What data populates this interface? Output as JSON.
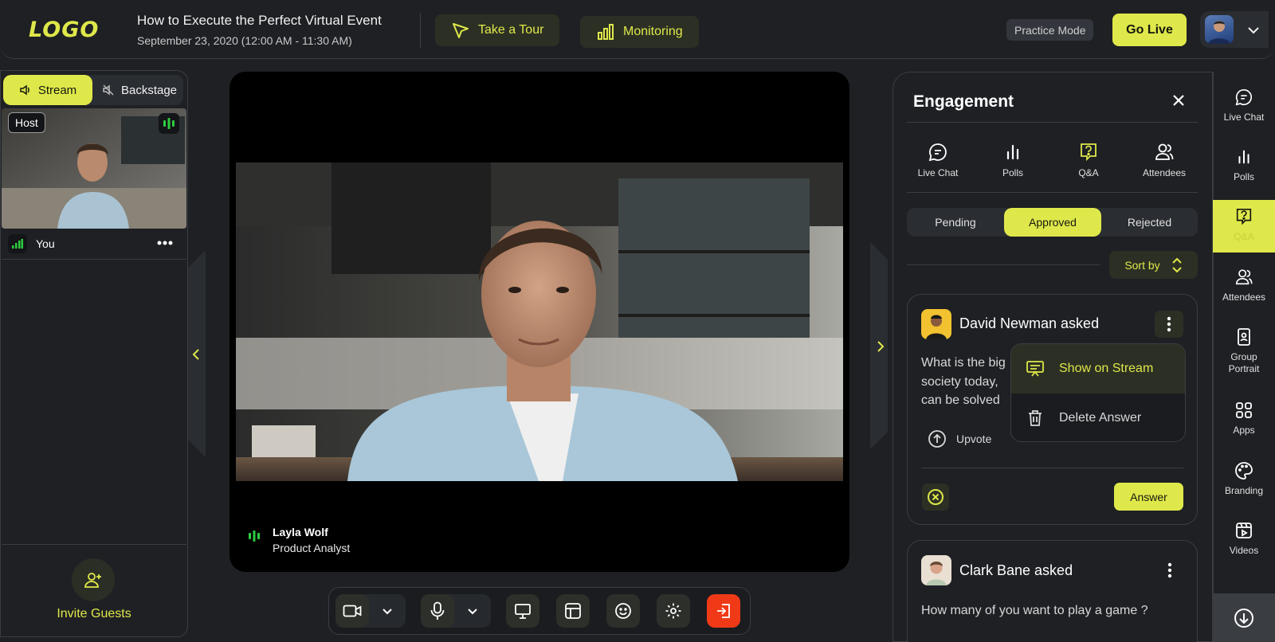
{
  "header": {
    "logo_text": "LOGO",
    "event_title": "How to Execute the Perfect Virtual Event",
    "event_date": "September 23, 2020 (12:00 AM - 11:30 AM)",
    "take_tour_label": "Take a Tour",
    "monitoring_label": "Monitoring",
    "practice_mode_label": "Practice Mode",
    "go_live_label": "Go Live"
  },
  "left_panel": {
    "stream_tab": "Stream",
    "backstage_tab": "Backstage",
    "host_badge": "Host",
    "self_name": "You",
    "invite_label": "Invite Guests"
  },
  "stage": {
    "speaker_name": "Layla Wolf",
    "speaker_role": "Product Analyst"
  },
  "engagement": {
    "title": "Engagement",
    "tabs": [
      {
        "label": "Live Chat",
        "icon": "chat-icon"
      },
      {
        "label": "Polls",
        "icon": "bar-chart-icon"
      },
      {
        "label": "Q&A",
        "icon": "question-icon"
      },
      {
        "label": "Attendees",
        "icon": "people-icon"
      }
    ],
    "filters": [
      "Pending",
      "Approved",
      "Rejected"
    ],
    "active_filter": "Approved",
    "sort_label": "Sort by",
    "questions": [
      {
        "asker": "David Newman asked",
        "text_lines": [
          "What is the big",
          "society today,",
          "can be solved"
        ],
        "upvote_label": "Upvote",
        "answer_label": "Answer"
      },
      {
        "asker": "Clark Bane asked",
        "text": "How many of you want to play a game ?"
      }
    ],
    "context_menu": {
      "show_on_stream": "Show on Stream",
      "delete_answer": "Delete Answer"
    }
  },
  "rail": {
    "items": [
      {
        "label": "Live Chat",
        "icon": "chat-icon"
      },
      {
        "label": "Polls",
        "icon": "bar-chart-icon"
      },
      {
        "label": "Q&A",
        "icon": "question-icon"
      },
      {
        "label": "Attendees",
        "icon": "people-icon"
      },
      {
        "label": "Group Portrait",
        "icon": "portrait-icon"
      },
      {
        "label": "Apps",
        "icon": "apps-grid-icon"
      },
      {
        "label": "Branding",
        "icon": "palette-icon"
      },
      {
        "label": "Videos",
        "icon": "video-icon"
      }
    ],
    "active": "Q&A"
  },
  "colors": {
    "accent": "#dfe84a",
    "background": "#1e2024",
    "danger": "#f03a17",
    "live_green": "#2ecc40"
  }
}
